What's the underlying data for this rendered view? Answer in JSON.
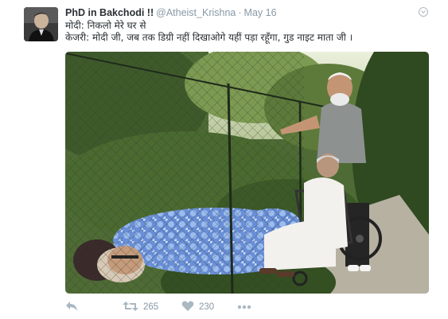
{
  "tweet": {
    "display_name": "PhD in Bakchodi !!",
    "handle": "@Atheist_Krishna",
    "separator": "·",
    "time": "May 16",
    "text_line_1": "मोदी: निकलो मेरे घर से",
    "text_line_2": "केजरी: मोदी जी, जब तक डिग्री नहीं दिखाओगे यहीं पड़ा रहूँगा, गुड नाइट माता जी ।"
  },
  "actions": {
    "reply_icon": "reply-icon",
    "retweet_icon": "retweet-icon",
    "retweet_count": "265",
    "like_icon": "heart-icon",
    "like_count": "230",
    "more_icon": "more-dots-icon"
  },
  "colors": {
    "text": "#292f33",
    "muted": "#8899a6",
    "icon": "#aab8c2"
  }
}
